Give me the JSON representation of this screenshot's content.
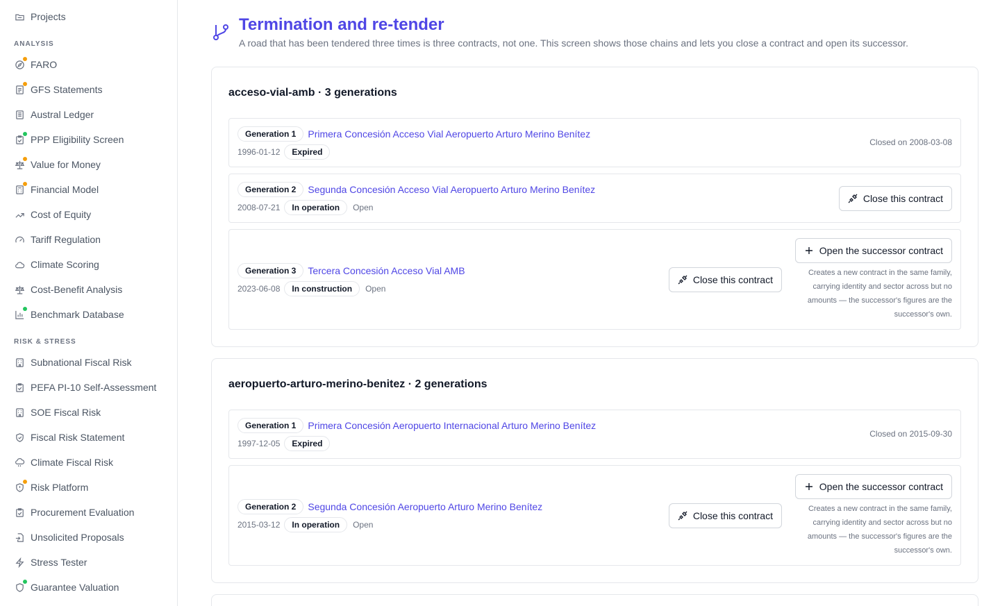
{
  "sidebar": {
    "top_item": {
      "label": "Projects",
      "icon": "folder-icon"
    },
    "sections": [
      {
        "label": "ANALYSIS",
        "items": [
          {
            "label": "FARO",
            "icon": "compass-icon",
            "dot": "orange"
          },
          {
            "label": "GFS Statements",
            "icon": "document-icon",
            "dot": "orange"
          },
          {
            "label": "Austral Ledger",
            "icon": "book-icon",
            "dot": ""
          },
          {
            "label": "PPP Eligibility Screen",
            "icon": "clipboard-check-icon",
            "dot": "green"
          },
          {
            "label": "Value for Money",
            "icon": "scale-icon",
            "dot": "orange"
          },
          {
            "label": "Financial Model",
            "icon": "calculator-icon",
            "dot": "orange"
          },
          {
            "label": "Cost of Equity",
            "icon": "trending-up-icon",
            "dot": ""
          },
          {
            "label": "Tariff Regulation",
            "icon": "gauge-icon",
            "dot": ""
          },
          {
            "label": "Climate Scoring",
            "icon": "cloud-icon",
            "dot": ""
          },
          {
            "label": "Cost-Benefit Analysis",
            "icon": "scale-icon",
            "dot": ""
          },
          {
            "label": "Benchmark Database",
            "icon": "bar-chart-icon",
            "dot": "green"
          }
        ]
      },
      {
        "label": "RISK & STRESS",
        "items": [
          {
            "label": "Subnational Fiscal Risk",
            "icon": "building-icon",
            "dot": ""
          },
          {
            "label": "PEFA PI-10 Self-Assessment",
            "icon": "clipboard-icon",
            "dot": ""
          },
          {
            "label": "SOE Fiscal Risk",
            "icon": "building-icon",
            "dot": ""
          },
          {
            "label": "Fiscal Risk Statement",
            "icon": "shield-check-icon",
            "dot": ""
          },
          {
            "label": "Climate Fiscal Risk",
            "icon": "cloud-rain-icon",
            "dot": ""
          },
          {
            "label": "Risk Platform",
            "icon": "shield-alert-icon",
            "dot": "orange"
          },
          {
            "label": "Procurement Evaluation",
            "icon": "clipboard-icon",
            "dot": ""
          },
          {
            "label": "Unsolicited Proposals",
            "icon": "file-import-icon",
            "dot": ""
          },
          {
            "label": "Stress Tester",
            "icon": "zap-icon",
            "dot": ""
          },
          {
            "label": "Guarantee Valuation",
            "icon": "shield-icon",
            "dot": "green"
          }
        ]
      }
    ]
  },
  "header": {
    "icon": "git-branch-icon",
    "title": "Termination and re-tender",
    "subtitle": "A road that has been tendered three times is three contracts, not one. This screen shows those chains and lets you close a contract and open its successor."
  },
  "actions": {
    "close_label": "Close this contract",
    "successor_label": "Open the successor contract",
    "successor_note": "Creates a new contract in the same family, carrying identity and sector across but no amounts — the successor's figures are the successor's own.",
    "open_label": "Open"
  },
  "chains": [
    {
      "title": "acceso-vial-amb · 3 generations",
      "generations": [
        {
          "gen": "Generation 1",
          "name": "Primera Concesión Acceso Vial Aeropuerto Arturo Merino Benítez",
          "date": "1996-01-12",
          "status": "Expired",
          "closed": "Closed on 2008-03-08"
        },
        {
          "gen": "Generation 2",
          "name": "Segunda Concesión Acceso Vial Aeropuerto Arturo Merino Benítez",
          "date": "2008-07-21",
          "status": "In operation"
        },
        {
          "gen": "Generation 3",
          "name": "Tercera Concesión Acceso Vial AMB",
          "date": "2023-06-08",
          "status": "In construction"
        }
      ]
    },
    {
      "title": "aeropuerto-arturo-merino-benitez · 2 generations",
      "generations": [
        {
          "gen": "Generation 1",
          "name": "Primera Concesión Aeropuerto Internacional Arturo Merino Benítez",
          "date": "1997-12-05",
          "status": "Expired",
          "closed": "Closed on 2015-09-30"
        },
        {
          "gen": "Generation 2",
          "name": "Segunda Concesión Aeropuerto Arturo Merino Benítez",
          "date": "2015-03-12",
          "status": "In operation"
        }
      ]
    }
  ]
}
